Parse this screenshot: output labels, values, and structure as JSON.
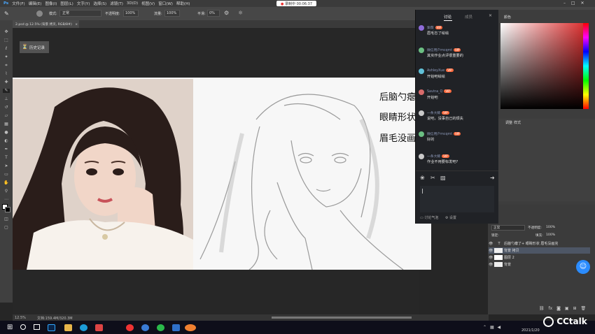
{
  "menu": [
    "文件(F)",
    "编辑(E)",
    "图像(I)",
    "图层(L)",
    "文字(Y)",
    "选择(S)",
    "滤镜(T)",
    "3D(D)",
    "视图(V)",
    "窗口(W)",
    "帮助(H)"
  ],
  "recording": {
    "label": "录制中",
    "time": "00:06:37"
  },
  "options": {
    "mode_label": "模式:",
    "mode_value": "正常",
    "opacity_label": "不透明度:",
    "opacity_value": "100%",
    "flow_label": "流量:",
    "flow_value": "100%",
    "smooth_label": "平滑:",
    "smooth_value": "0%"
  },
  "document_tab": "2.psd @ 12.5% (背景 拷贝, RGB/8#)",
  "history_panel": {
    "label": "历史记录"
  },
  "canvas_text": [
    "后脑勺瘪了",
    "眼睛形状",
    "眉毛没画完"
  ],
  "chat": {
    "tabs": [
      "讨论",
      "成员"
    ],
    "messages": [
      {
        "name": "紫薇",
        "text": "眉毛忘了绘绘",
        "color": "#8e6bd8"
      },
      {
        "name": "微信用户mcqmt",
        "text": "其实作业点评很重要的",
        "color": "#6bbf83"
      },
      {
        "name": "AshleyXue",
        "text": "开始吧绘绘",
        "color": "#61c1d8"
      },
      {
        "name": "Savina_Q",
        "text": "开始吧",
        "color": "#d86b6b"
      },
      {
        "name": "一条大鲸",
        "text": "说吧，没事自己的烦失",
        "color": "#c9c9c9"
      },
      {
        "name": "微信用户mcqmt",
        "text": "好的",
        "color": "#6bbf83"
      },
      {
        "name": "一条大鲸",
        "text": "作业不用要标发吧?",
        "color": "#c9c9c9"
      }
    ],
    "badge": "VIP",
    "footer": {
      "left": "讨论气泡",
      "right": "设置"
    }
  },
  "right_panel": {
    "color_tab": "颜色",
    "adjust_tabs": [
      "调整",
      "样式"
    ],
    "properties_tabs": [
      "通道",
      "路径"
    ],
    "blend_mode": "正常",
    "opacity_label": "不透明度:",
    "opacity_value": "100%",
    "fill_label": "填充:",
    "fill_value": "100%",
    "lock_label": "锁定:"
  },
  "layers": [
    {
      "name": "后脑勺瘪了+ 眼睛形状 眉毛没画完"
    },
    {
      "name": "背景 拷贝"
    },
    {
      "name": "图层 2"
    },
    {
      "name": "背景"
    }
  ],
  "status": {
    "zoom": "12.5%",
    "doc": "文档:159.4M/320.3M"
  },
  "taskbar": {
    "time": "2021/1/20"
  },
  "brand": "CCtalk"
}
